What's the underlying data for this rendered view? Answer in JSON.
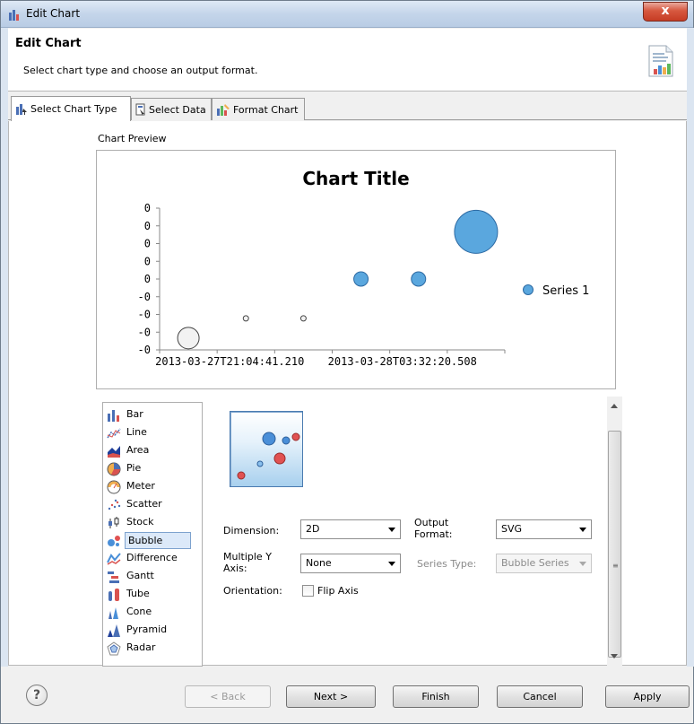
{
  "window": {
    "title": "Edit Chart",
    "close_label": "x"
  },
  "header": {
    "title": "Edit Chart",
    "description": "Select chart type and choose an output format."
  },
  "tabs": [
    {
      "label": "Select Chart Type",
      "icon": "chart-type-icon",
      "active": true
    },
    {
      "label": "Select Data",
      "icon": "select-data-icon",
      "active": false
    },
    {
      "label": "Format Chart",
      "icon": "format-chart-icon",
      "active": false
    }
  ],
  "preview": {
    "label": "Chart Preview"
  },
  "chart_data": {
    "type": "scatter",
    "title": "Chart Title",
    "xlabel": "",
    "ylabel": "",
    "x_tick_labels": [
      "2013-03-27T21:04:41.210",
      "2013-03-28T03:32:20.508"
    ],
    "y_tick_labels": [
      "0",
      "0",
      "0",
      "0",
      "0",
      "-0",
      "-0",
      "-0",
      "-0"
    ],
    "legend": {
      "position": "right",
      "entries": [
        "Series 1"
      ]
    },
    "series": [
      {
        "name": "Series 1",
        "color": "#5aa7de",
        "points": [
          {
            "x": 1,
            "y": 0.0,
            "size": 12,
            "negative": true
          },
          {
            "x": 2,
            "y": 0.5,
            "size": 3,
            "negative": true
          },
          {
            "x": 3,
            "y": 0.5,
            "size": 3,
            "negative": true
          },
          {
            "x": 4,
            "y": 1.5,
            "size": 8,
            "negative": false
          },
          {
            "x": 5,
            "y": 1.5,
            "size": 8,
            "negative": false
          },
          {
            "x": 6,
            "y": 2.7,
            "size": 24,
            "negative": false
          }
        ]
      }
    ],
    "grid": false
  },
  "chart_types": [
    {
      "label": "Bar",
      "icon": "bar-chart-icon"
    },
    {
      "label": "Line",
      "icon": "line-chart-icon"
    },
    {
      "label": "Area",
      "icon": "area-chart-icon"
    },
    {
      "label": "Pie",
      "icon": "pie-chart-icon"
    },
    {
      "label": "Meter",
      "icon": "meter-chart-icon"
    },
    {
      "label": "Scatter",
      "icon": "scatter-chart-icon"
    },
    {
      "label": "Stock",
      "icon": "stock-chart-icon"
    },
    {
      "label": "Bubble",
      "icon": "bubble-chart-icon",
      "selected": true
    },
    {
      "label": "Difference",
      "icon": "difference-chart-icon"
    },
    {
      "label": "Gantt",
      "icon": "gantt-chart-icon"
    },
    {
      "label": "Tube",
      "icon": "tube-chart-icon"
    },
    {
      "label": "Cone",
      "icon": "cone-chart-icon"
    },
    {
      "label": "Pyramid",
      "icon": "pyramid-chart-icon"
    },
    {
      "label": "Radar",
      "icon": "radar-chart-icon"
    }
  ],
  "options": {
    "dimension_label": "Dimension:",
    "dimension_value": "2D",
    "output_format_label": "Output Format:",
    "output_format_value": "SVG",
    "multiple_y_axis_label": "Multiple Y Axis:",
    "multiple_y_axis_value": "None",
    "series_type_label": "Series Type:",
    "series_type_value": "Bubble Series",
    "orientation_label": "Orientation:",
    "flip_axis_label": "Flip Axis",
    "flip_axis_checked": false
  },
  "footer": {
    "help_label": "?",
    "back_label": "< Back",
    "next_label": "Next >",
    "finish_label": "Finish",
    "cancel_label": "Cancel",
    "apply_label": "Apply"
  }
}
